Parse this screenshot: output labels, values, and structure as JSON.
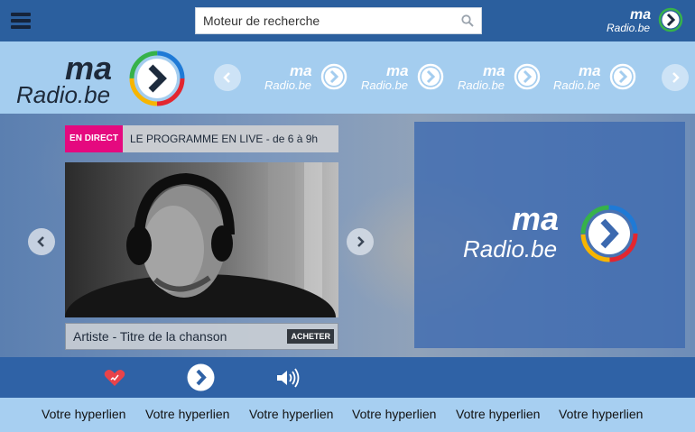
{
  "search": {
    "placeholder": "Moteur de recherche"
  },
  "brand": {
    "top": "ma",
    "bottom": "Radio.be"
  },
  "live": {
    "badge": "EN DIRECT",
    "program": "LE PROGRAMME EN LIVE - de 6 à 9h"
  },
  "track": {
    "text": "Artiste - Titre de la chanson",
    "buy_label": "ACHETER"
  },
  "player": {
    "icons": [
      "heart-icon",
      "play-icon",
      "volume-icon"
    ]
  },
  "links": [
    "Votre hyperlien",
    "Votre hyperlien",
    "Votre hyperlien",
    "Votre hyperlien",
    "Votre hyperlien",
    "Votre hyperlien"
  ],
  "colors": {
    "topbar": "#2b5f9e",
    "band": "#a4cdef",
    "live_badge": "#e5097f",
    "player": "#2f62a6",
    "links_bar": "#a7cff1",
    "heart": "#e8434a"
  }
}
